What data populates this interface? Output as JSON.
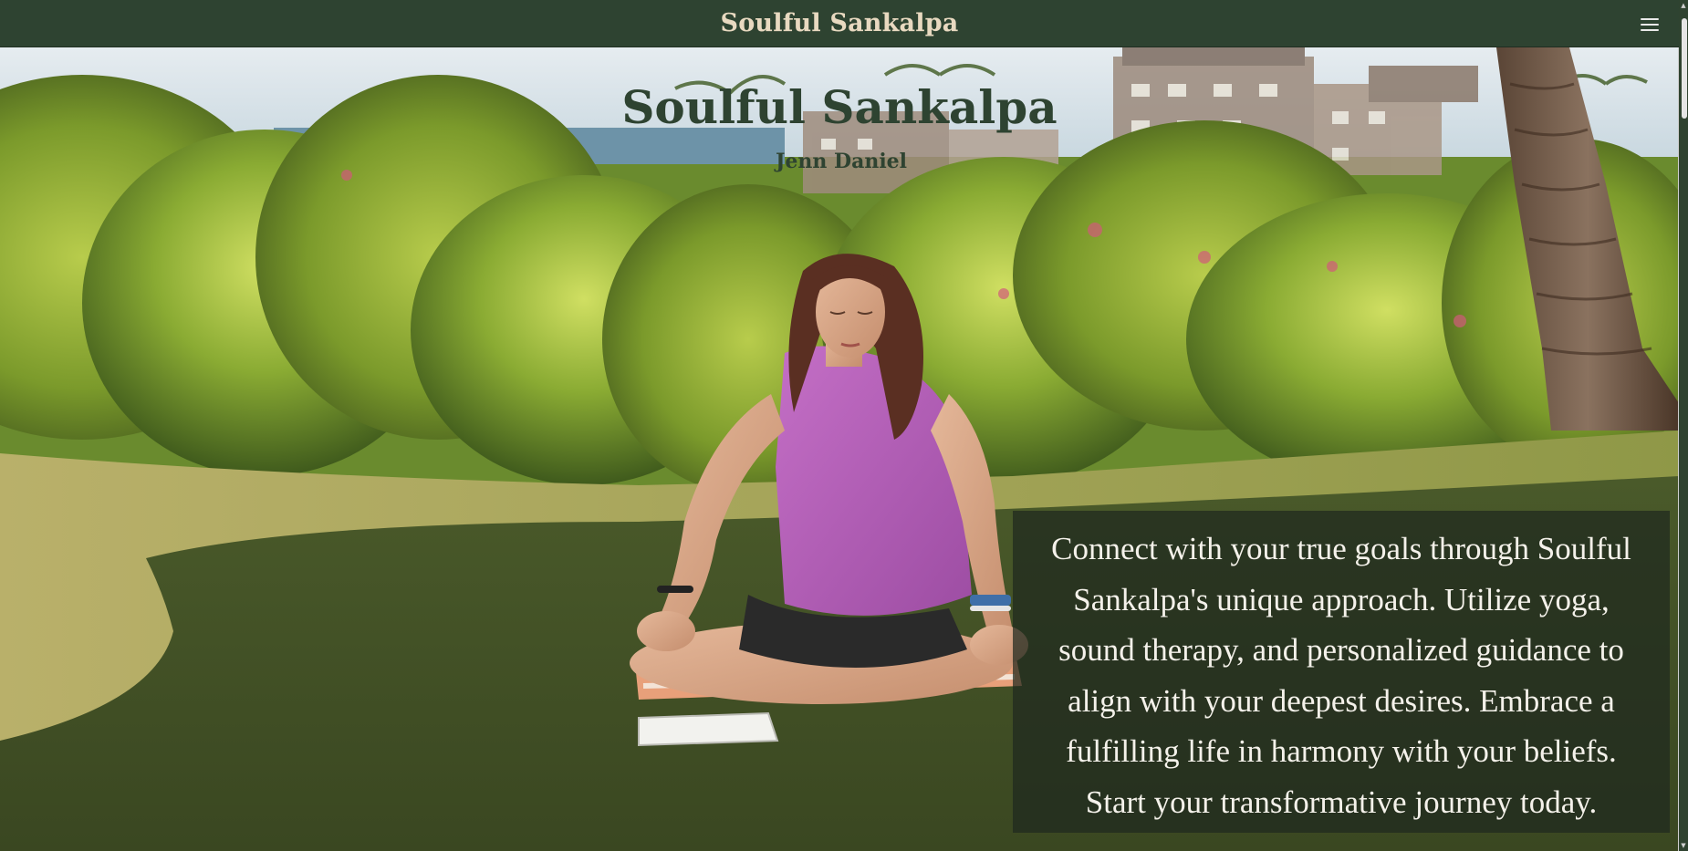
{
  "topbar": {
    "title": "Soulful Sankalpa",
    "menu_icon": "hamburger-menu-icon"
  },
  "hero": {
    "title": "Soulful Sankalpa",
    "subtitle": "Jenn Daniel",
    "intro": "Connect with your true goals through Soulful Sankalpa's unique approach. Utilize yoga, sound therapy, and personalized guidance to align with your deepest desires. Embrace a fulfilling life in harmony with your beliefs. Start your transformative journey today."
  },
  "colors": {
    "brand_dark_green": "#2e4331",
    "topbar_text": "#e8d9c0",
    "overlay": "rgba(30,40,30,0.72)",
    "overlay_text": "#f4f1ea"
  }
}
